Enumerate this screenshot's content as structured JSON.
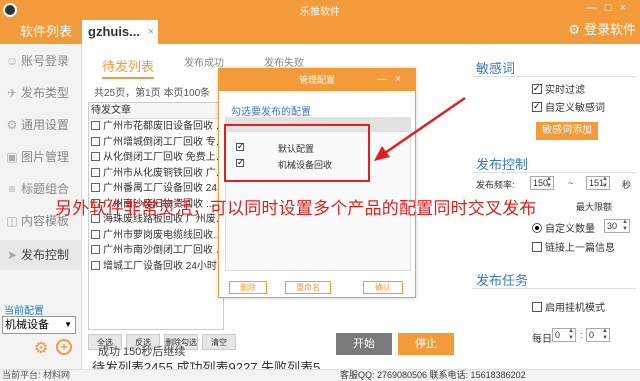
{
  "titlebar": {
    "app_title": "乐推软件",
    "tab_list": "软件列表",
    "tab_user": "gzhuis...",
    "tab_close": "×",
    "login": "登录软件",
    "window_controls": [
      "—",
      "□",
      "×"
    ]
  },
  "sidebar": {
    "items": [
      {
        "icon": "user-icon",
        "glyph": "☺",
        "label": "账号登录"
      },
      {
        "icon": "send-icon",
        "glyph": "✈",
        "label": "发布类型"
      },
      {
        "icon": "gear-icon",
        "glyph": "⚙",
        "label": "通用设置"
      },
      {
        "icon": "image-icon",
        "glyph": "▣",
        "label": "图片管理"
      },
      {
        "icon": "combine-icon",
        "glyph": "≡",
        "label": "标题组合"
      },
      {
        "icon": "template-icon",
        "glyph": "◫",
        "label": "内容模板"
      },
      {
        "icon": "publish-icon",
        "glyph": "➤",
        "label": "发布控制"
      }
    ],
    "current_config_label": "当前配置",
    "current_config_value": "机械设备"
  },
  "main": {
    "tabs": [
      "待发列表",
      "发布成功",
      "发布失败"
    ],
    "pager": "共25页，第1页 本页100条",
    "list_header": "待发文章",
    "articles": [
      "广州市花都废旧设备回收 …",
      "广州增城倒闭工厂回收 专…",
      "从化倒闭工厂回收 免费上…",
      "广州市从化废铜铁回收 广…",
      "广州番禺工厂设备回收 24…",
      "广州南沙废旧物资回收 …",
      "海珠废线路板回收 广州废…",
      "广州市萝岗废电缆线回收…",
      "广州市南沙倒闭工厂回收 …",
      "增城工厂设备回收 24小时…"
    ],
    "buttons": [
      "全选",
      "反选",
      "删除勾选",
      "清空"
    ],
    "stats": "待发列表2455 成功列表9227 失败列表5",
    "status": "成功 150秒后继续",
    "start_btn": "开始",
    "stop_btn": "停止"
  },
  "right": {
    "sensitive_title": "敏感词",
    "realtime_filter": "实时过滤",
    "custom_sensitive": "自定义敏感词",
    "add_sensitive_btn": "敏感词添加",
    "control_title": "发布控制",
    "freq_label": "发布频率:",
    "freq_min": "150",
    "freq_sep": "~",
    "freq_max": "151",
    "freq_unit": "秒",
    "max_amount": "最大限额",
    "custom_amount": "自定义数量",
    "custom_amount_value": "30",
    "link_prev": "链接上一篇信息",
    "task_title": "发布任务",
    "hangup_mode": "启用挂机模式",
    "daily_label": "每日",
    "time_h": "0",
    "time_sep": ":",
    "time_m": "0"
  },
  "dialog": {
    "title": "管理配置",
    "controls": [
      "—",
      "×"
    ],
    "prompt": "勾选要发布的配置",
    "configs": [
      {
        "name": "默认配置",
        "checked": true
      },
      {
        "name": "机械设备回收",
        "checked": true
      }
    ],
    "delete_btn": "删除",
    "rename_btn": "重命名",
    "confirm_btn": "确认"
  },
  "annotation": {
    "text": "另外软件非常灵活，可以同时设置多个产品的配置同时交叉发布",
    "color": "#e02020"
  },
  "statusbar": {
    "platform": "当前平台: 材料网",
    "contact": "客服QQ: 2769080506  联系电话: 15618386202"
  },
  "colors": {
    "brand": "#f39a3b",
    "section_title": "#3d7ab3",
    "annotation": "#e02020"
  }
}
